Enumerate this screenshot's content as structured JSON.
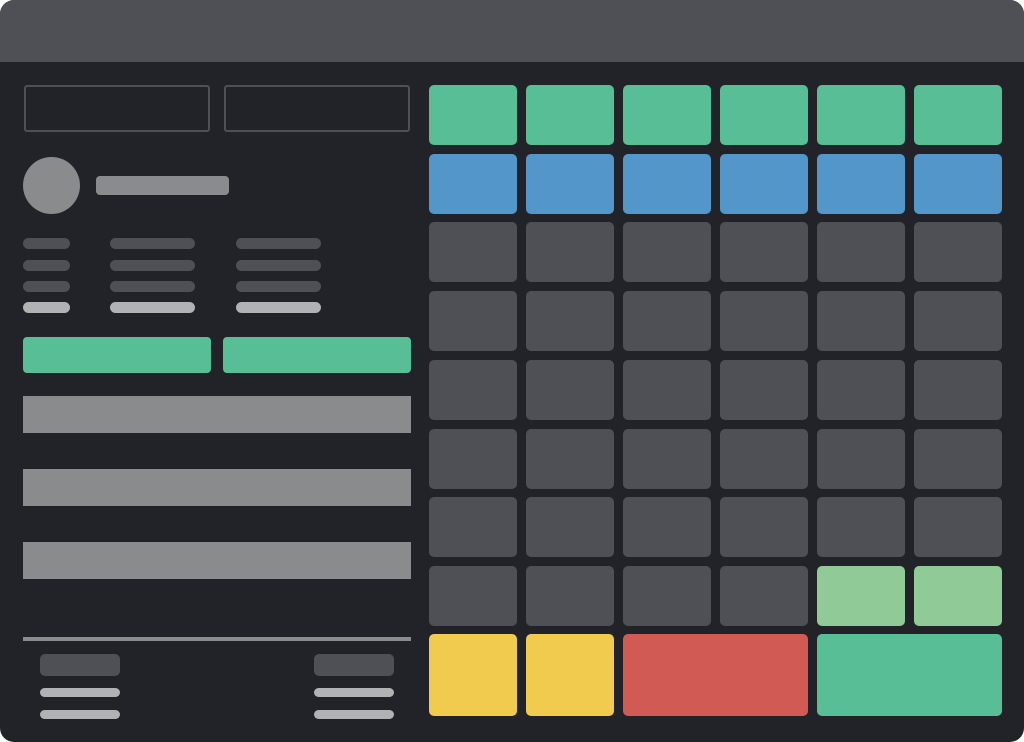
{
  "colors": {
    "window_bg": "#212329",
    "titlebar": "#4f5055",
    "pad_default": "#4f5055",
    "green": "#57be95",
    "blue": "#5296ca",
    "light_green": "#8fca97",
    "yellow": "#f1cb4e",
    "red": "#d15a54",
    "grey": "#8a8b8d",
    "light_grey": "#b1b2b4"
  },
  "pad_grid": {
    "rows": 8,
    "columns": 6,
    "row_colors": [
      "green",
      "blue",
      "default",
      "default",
      "default",
      "default",
      "default",
      "mixed"
    ],
    "row8_colors": [
      "default",
      "default",
      "default",
      "default",
      "light_green",
      "light_green"
    ]
  },
  "bottom_row": [
    {
      "name": "yellow-pad-1",
      "color": "yellow",
      "span": 1
    },
    {
      "name": "yellow-pad-2",
      "color": "yellow",
      "span": 1
    },
    {
      "name": "red-wide-pad",
      "color": "red",
      "span": 2
    },
    {
      "name": "green-wide-pad",
      "color": "green",
      "span": 2
    }
  ],
  "icons": [
    "avatar-icon"
  ]
}
